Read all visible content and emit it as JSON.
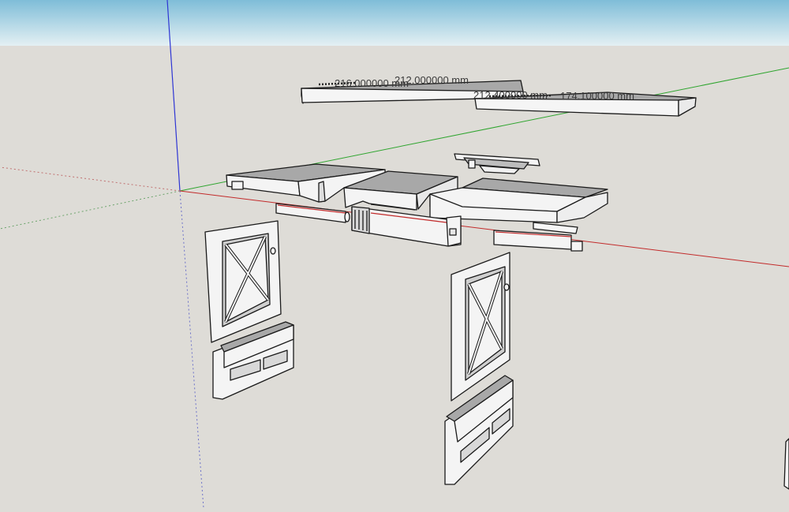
{
  "dimensions": [
    {
      "id": "dim-1",
      "text": "216.000000 mm"
    },
    {
      "id": "dim-2",
      "text": "212.000000 mm"
    },
    {
      "id": "dim-3",
      "text": "212.400000 mm"
    },
    {
      "id": "dim-4",
      "text": "174.100000 mm"
    }
  ],
  "colors": {
    "sky_top": "#8fc6dd",
    "sky_bottom": "#dfeef3",
    "ground": "#dedcd7",
    "axis_blue": "#2e35d4",
    "axis_green": "#2fa52f",
    "axis_red": "#c22a2a",
    "part_face": "#f4f4f4",
    "part_top": "#a8a8a8",
    "edge": "#1a1a1a"
  }
}
